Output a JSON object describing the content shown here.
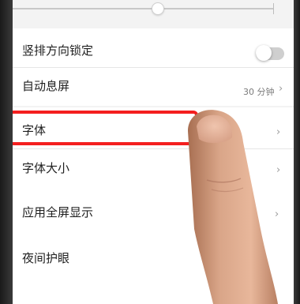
{
  "settings": {
    "rows": [
      {
        "label": "竖排方向锁定",
        "control": "toggle",
        "state": "off"
      },
      {
        "label": "自动息屏",
        "value": "30 分钟",
        "chevron": "›"
      },
      {
        "label": "字体",
        "chevron": "›",
        "highlighted": true
      },
      {
        "label": "字体大小",
        "chevron": "›"
      },
      {
        "label": "应用全屏显示",
        "chevron": "›"
      },
      {
        "label": "夜间护眼"
      }
    ],
    "brightness_slider": {
      "level": 0.55
    }
  },
  "icons": {
    "chevron": "chevron-right-icon",
    "toggle": "toggle-switch"
  },
  "colors": {
    "highlight": "#f41f1f",
    "background": "#f3f3f3",
    "row": "#ffffff",
    "text": "#1f1f1f",
    "secondary_text": "#7a7a7a"
  }
}
